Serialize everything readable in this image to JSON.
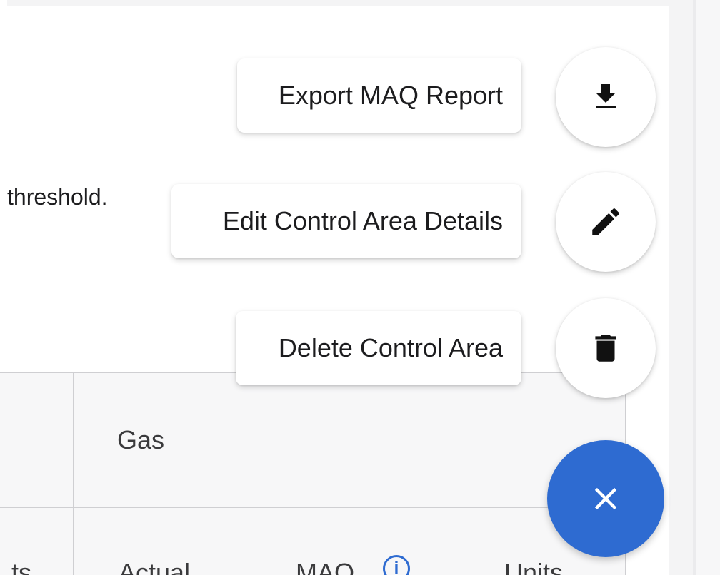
{
  "panel": {
    "partial_text": "threshold."
  },
  "table": {
    "group_header": "Gas",
    "columns": {
      "partial_left": "ts",
      "actual": "Actual",
      "maq": "MAQ",
      "units": "Units"
    }
  },
  "speed_dial": {
    "actions": [
      {
        "label": "Export MAQ Report",
        "icon": "download-icon"
      },
      {
        "label": "Edit Control Area Details",
        "icon": "pencil-icon"
      },
      {
        "label": "Delete Control Area",
        "icon": "trash-icon"
      }
    ],
    "close_icon": "close-icon"
  },
  "colors": {
    "accent": "#2e6bd1",
    "text": "#1c1c1e",
    "border": "#cfcfd2"
  }
}
